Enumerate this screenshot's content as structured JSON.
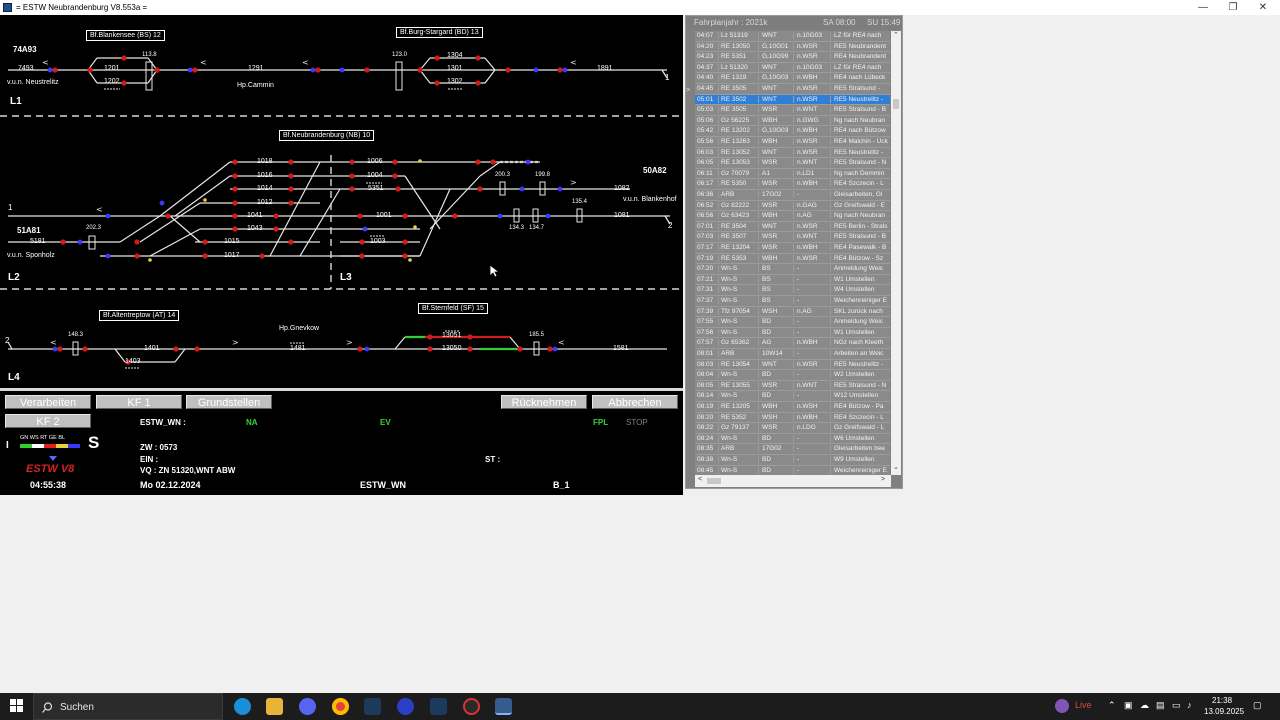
{
  "window": {
    "title": "= ESTW  Neubrandenburg  V8.553a =",
    "minimize_label": "—",
    "maximize_label": "❐",
    "close_label": "✕"
  },
  "estw": {
    "stations": {
      "blankensee": "Bf.Blankensee (BS) 12",
      "burg_stargard": "Bf.Burg-Stargard (BD) 13",
      "neubrandenburg": "Bf.Neubrandenburg (NB) 10",
      "altentreptow": "Bf.Altentreptow (AT) 14",
      "sternfeld": "Bf.Sternfeld (SF) 15"
    },
    "halts": {
      "cammin": "Hp.Cammin",
      "gnevkow": "Hp.Gnevkow"
    },
    "line_labels": {
      "l1": "L1",
      "l2": "L2",
      "l3": "L3",
      "l4": "L4"
    },
    "block_labels": {
      "b74a93": "74A93",
      "b51a81": "51A81",
      "b50a82": "50A82",
      "vun_neustrelitz": "v.u.n. Neustrelitz",
      "vun_sponholz": "v.u.n. Sponholz",
      "vun_blankenhof": "v.u.n. Blankenhof"
    },
    "track_numbers": {
      "t7493": "7493",
      "t1201": "1201",
      "t1202": "1202",
      "t1291": "1291",
      "k1138": "113.8",
      "t1304": "1304",
      "t1301": "1301",
      "t1302": "1302",
      "t1891": "1891",
      "k1230": "123.0",
      "t1018": "1018",
      "t1016": "1016",
      "t1014": "1014",
      "t1012": "1012",
      "t1041": "1041",
      "t1043": "1043",
      "t1015": "1015",
      "t1017": "1017",
      "t5181": "5181",
      "k2023": "202.3",
      "t1006": "1006",
      "t1004": "1004",
      "t5351": "5351",
      "t1001": "1001",
      "t1003": "1003",
      "k2003": "200.3",
      "k1998": "199.8",
      "t1082": "1082",
      "t1081": "1081",
      "k1354": "135.4",
      "k1343": "134.3",
      "k1347": "134.7",
      "k1483": "148.3",
      "t1401": "1401",
      "t1403": "1403",
      "t1481": "1481",
      "t13051": "13051",
      "t13050": "13050",
      "k1855": "185.5",
      "t1581": "1581"
    },
    "edge_numbers": {
      "n1_right": "1",
      "n1_left": "1",
      "n2_right": "2",
      "n2_left": "2"
    },
    "buttons": {
      "verarbeiten": "Verarbeiten",
      "kf1": "KF 1",
      "grundstellen": "Grundstellen",
      "kf2": "KF 2",
      "ruecknehmen": "Rücknehmen",
      "abbrechen": "Abbrechen"
    },
    "status": {
      "estw_wn_label": "ESTW_WN :",
      "na": "NA",
      "ev": "EV",
      "fpl": "FPL",
      "stop": "STOP",
      "zw": "ZW :  0573",
      "ein": "EIN :",
      "vq": "VQ   :  ZN 51320,WNT ABW",
      "st": "ST :",
      "time": "04:55:38",
      "date": "Mo   02.12.2024",
      "estw_wn": "ESTW_WN",
      "b1": "B_1",
      "color_legend": [
        "GN",
        "WS",
        "RT",
        "GE",
        "BL"
      ],
      "s_marker": "S",
      "i_marker": "I",
      "logo": "ESTW V8"
    }
  },
  "fahrplan": {
    "title": "Fahrplanjahr : 2021k",
    "sa": "SA 08:00",
    "su": "SU 15:49",
    "selected_index": 6,
    "rows": [
      [
        "04:07",
        "Lz 51319",
        "WNT",
        "n.10G03",
        "LZ für RE4 nach"
      ],
      [
        "04:20",
        "RE 13050",
        "G,10G01",
        "n.WSR",
        "RE5 Neubrandent"
      ],
      [
        "04:23",
        "RE 5351",
        "G,10G99",
        "n.WSR",
        "RE4 Neubrandent"
      ],
      [
        "04:37",
        "Lz 51320",
        "WNT",
        "n.10G03",
        "LZ für RE4 nach"
      ],
      [
        "04:40",
        "RE 1319",
        "G,10G03",
        "n.WBH",
        "RE4 nach Lübeck"
      ],
      [
        "04:45",
        "RE 3505",
        "WNT",
        "n.WSR",
        "RE5 Stralsund -"
      ],
      [
        "05:01",
        "RE 3502",
        "WNT",
        "n.WSR",
        "RE5 Neustrelitz -"
      ],
      [
        "05:03",
        "RE 3505",
        "WSR",
        "n.WNT",
        "RE5 Stralsund - B"
      ],
      [
        "05:06",
        "Gz 56225",
        "WBH",
        "n.GWG",
        "Ng nach Neubran"
      ],
      [
        "05:42",
        "RE 13202",
        "G,10G03",
        "n.WBH",
        "RE4 nach Bützow"
      ],
      [
        "05:56",
        "RE 13263",
        "WBH",
        "n.WSR",
        "RE4 Malchin - Ück"
      ],
      [
        "06:03",
        "RE 13052",
        "WNT",
        "n.WSR",
        "RE5 Neustrelitz -"
      ],
      [
        "06:05",
        "RE 13053",
        "WSR",
        "n.WNT",
        "RE5 Stralsund - N"
      ],
      [
        "06:11",
        "Gz 70079",
        "A1",
        "n.LD1",
        "Ng nach Demmin"
      ],
      [
        "06:17",
        "RE 5350",
        "WSR",
        "n.WBH",
        "RE4 Szczecin - L"
      ],
      [
        "06:36",
        "ARB",
        "17G02",
        "-",
        "Gleisarbeiten, Gl"
      ],
      [
        "06:52",
        "Gz 82222",
        "WSR",
        "n.GAG",
        "Gz Greifswald - E"
      ],
      [
        "06:56",
        "Gz 63423",
        "WBH",
        "n.AG",
        "Ng nach Neubran"
      ],
      [
        "07:01",
        "RE 3504",
        "WNT",
        "n.WSR",
        "RE5 Berlin - Strals"
      ],
      [
        "07:03",
        "RE 3507",
        "WSR",
        "n.WNT",
        "RE5 Stralsund - B"
      ],
      [
        "07:17",
        "RE 13204",
        "WSR",
        "n.WBH",
        "RE4 Pasewalk - B"
      ],
      [
        "07:19",
        "RE 5353",
        "WBH",
        "n.WSR",
        "RE4 Bützow - Sz"
      ],
      [
        "07:20",
        "Wn-S",
        "BS",
        "-",
        "Anmeldung Weic"
      ],
      [
        "07:21",
        "Wn-S",
        "BS",
        "-",
        "W1 Umstellen"
      ],
      [
        "07:31",
        "Wn-S",
        "BS",
        "-",
        "W4 Umstellen"
      ],
      [
        "07:37",
        "Wn-S",
        "BS",
        "-",
        "Weichenreiniger E"
      ],
      [
        "07:39",
        "Tfz 97054",
        "WSH",
        "n.AG",
        "SKL zurück nach"
      ],
      [
        "07:55",
        "Wn-S",
        "BD",
        "-",
        "Anmeldung Weic"
      ],
      [
        "07:56",
        "Wn-S",
        "BD",
        "-",
        "W1 Umstellen"
      ],
      [
        "07:57",
        "Gz 65362",
        "AG",
        "n.WBH",
        "NGz nach Kleeth"
      ],
      [
        "08:01",
        "ARB",
        "10W14",
        "-",
        "Arbeiten an Weic"
      ],
      [
        "08:03",
        "RE 13054",
        "WNT",
        "n.WSR",
        "RE5 Neustrelitz -"
      ],
      [
        "08:04",
        "Wn-S",
        "BD",
        "-",
        "W2 Umstellen"
      ],
      [
        "08:05",
        "RE 13055",
        "WSR",
        "n.WNT",
        "RE5 Stralsund - N"
      ],
      [
        "08:14",
        "Wn-S",
        "BD",
        "-",
        "W12 Umstellen"
      ],
      [
        "08:19",
        "RE 13205",
        "WBH",
        "n.WSH",
        "RE4 Bützow - Pa"
      ],
      [
        "08:20",
        "RE 5352",
        "WSH",
        "n.WBH",
        "RE4 Szczecin - L"
      ],
      [
        "08:22",
        "Gz 79137",
        "WSR",
        "n.LDG",
        "Gz Greifswald - L"
      ],
      [
        "08:24",
        "Wn-S",
        "BD",
        "-",
        "W6 Umstellen"
      ],
      [
        "08:35",
        "ARB",
        "17G02",
        "-",
        "Gleisarbeiten bee"
      ],
      [
        "08:38",
        "Wn-S",
        "BD",
        "-",
        "W9 Umstellen"
      ],
      [
        "08:45",
        "Wn-S",
        "BD",
        "-",
        "Weichenreiniger E"
      ]
    ]
  },
  "taskbar": {
    "search_placeholder": "Suchen",
    "live": "Live",
    "time": "21:38",
    "date": "13.09.2025"
  }
}
